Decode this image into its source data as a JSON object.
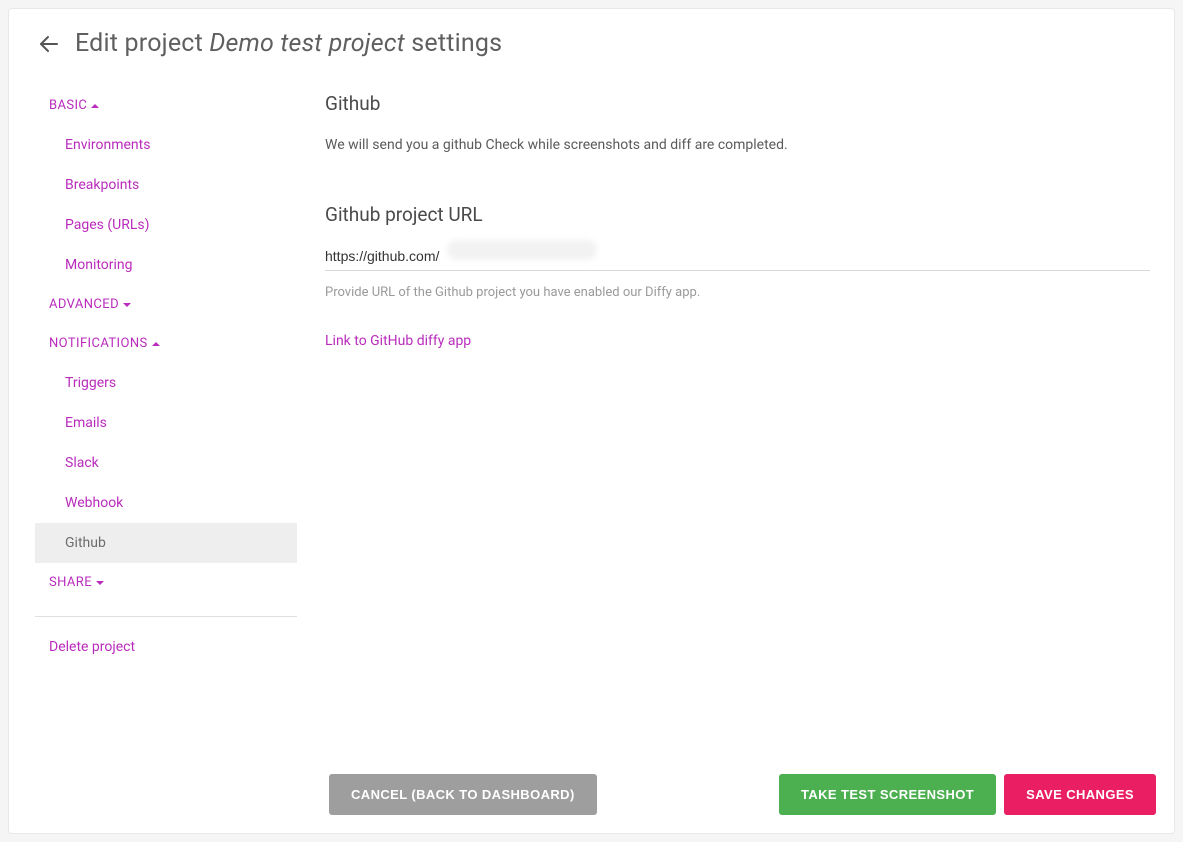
{
  "header": {
    "title_prefix": "Edit project ",
    "project_name": "Demo test project",
    "title_suffix": " settings"
  },
  "sidebar": {
    "basic": {
      "label": "BASIC",
      "expanded": true,
      "items": [
        "Environments",
        "Breakpoints",
        "Pages (URLs)",
        "Monitoring"
      ]
    },
    "advanced": {
      "label": "ADVANCED",
      "expanded": false
    },
    "notifications": {
      "label": "NOTIFICATIONS",
      "expanded": true,
      "items": [
        "Triggers",
        "Emails",
        "Slack",
        "Webhook",
        "Github"
      ],
      "active": "Github"
    },
    "share": {
      "label": "SHARE",
      "expanded": false
    },
    "delete_label": "Delete project"
  },
  "main": {
    "section_title": "Github",
    "section_desc": "We will send you a github Check while screenshots and diff are completed.",
    "field_label": "Github project URL",
    "field_value": "https://github.com/",
    "field_hint": "Provide URL of the Github project you have enabled our Diffy app.",
    "app_link": "Link to GitHub diffy app"
  },
  "footer": {
    "cancel": "CANCEL (BACK TO DASHBOARD)",
    "test": "TAKE TEST SCREENSHOT",
    "save": "SAVE CHANGES"
  }
}
